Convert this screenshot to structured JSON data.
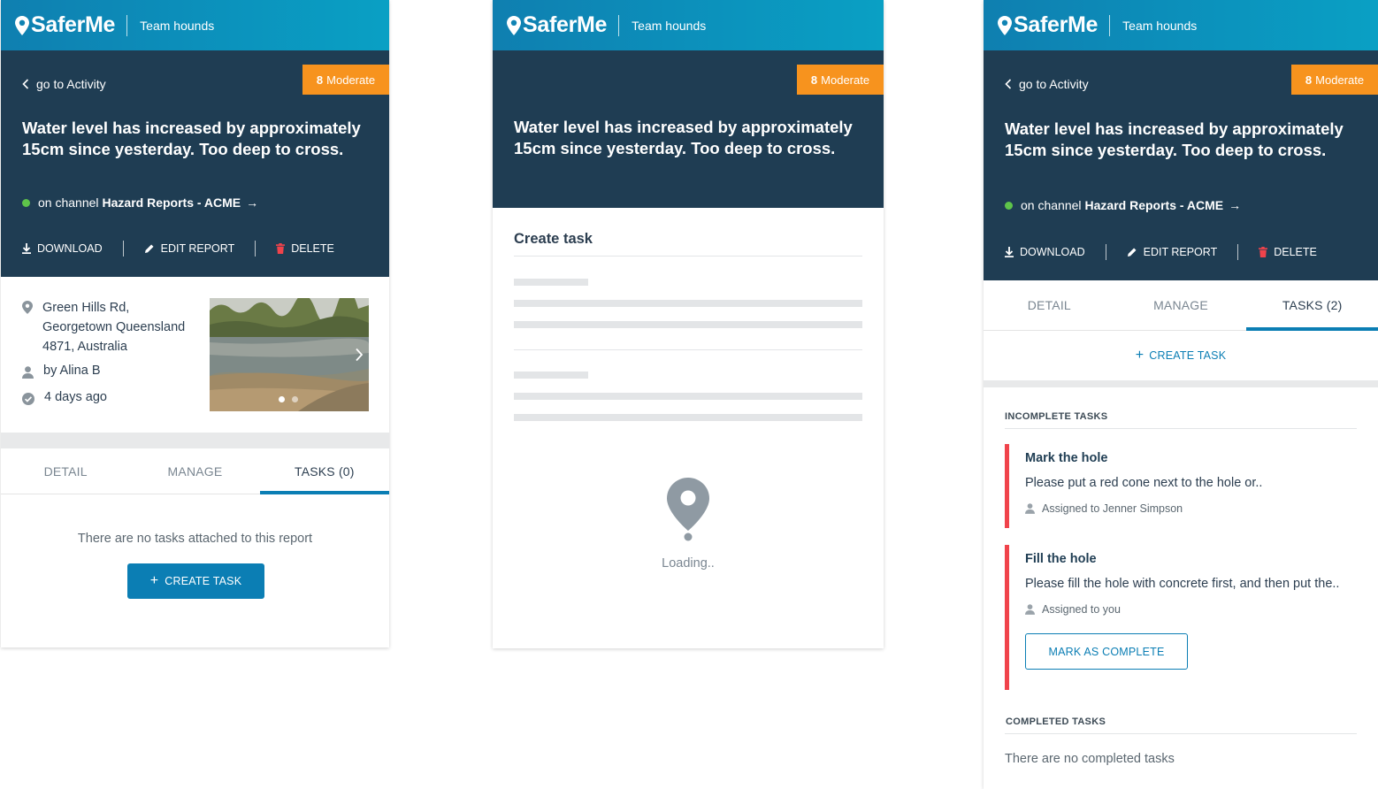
{
  "brand": {
    "name": "SaferMe",
    "team": "Team hounds"
  },
  "report": {
    "back_label": "go to Activity",
    "severity_num": "8",
    "severity_label": "Moderate",
    "title": "Water level has increased by approximately 15cm since yesterday. Too deep to cross.",
    "channel_prefix": "on channel",
    "channel_name": "Hazard Reports - ACME",
    "channel_arrow": "→",
    "actions": {
      "download": "DOWNLOAD",
      "edit": "EDIT REPORT",
      "delete": "DELETE"
    },
    "address_lines": [
      "Green Hills Rd,",
      "Georgetown Queensland",
      "4871, Australia"
    ],
    "author": "by Alina B",
    "time": "4 days ago",
    "photo_count": 2,
    "photo_active": 1
  },
  "colors": {
    "accent": "#0b7eb4",
    "hero": "#1f3d53",
    "severity": "#f7931e",
    "task_flag": "#f0434b",
    "channel_dot": "#5ec44a"
  },
  "screen1": {
    "tabs": [
      "DETAIL",
      "MANAGE",
      "TASKS (0)"
    ],
    "active_tab": 2,
    "empty_text": "There are no tasks attached to this report",
    "create_task_label": "CREATE TASK",
    "create_icon": "+"
  },
  "screen2": {
    "heading": "Create task",
    "loading_text": "Loading.."
  },
  "screen3": {
    "tabs": [
      "DETAIL",
      "MANAGE",
      "TASKS (2)"
    ],
    "active_tab": 2,
    "create_task_label": "CREATE TASK",
    "create_icon": "+",
    "incomplete_heading": "INCOMPLETE TASKS",
    "tasks": [
      {
        "title": "Mark the hole",
        "description": "Please put a red cone next to the hole or..",
        "assigned": "Assigned to Jenner Simpson"
      },
      {
        "title": "Fill the hole",
        "description": "Please fill the hole with concrete first, and then put the..",
        "assigned": "Assigned to you",
        "action_label": "MARK AS COMPLETE"
      }
    ],
    "completed_heading": "COMPLETED TASKS",
    "completed_empty": "There are no completed tasks"
  }
}
